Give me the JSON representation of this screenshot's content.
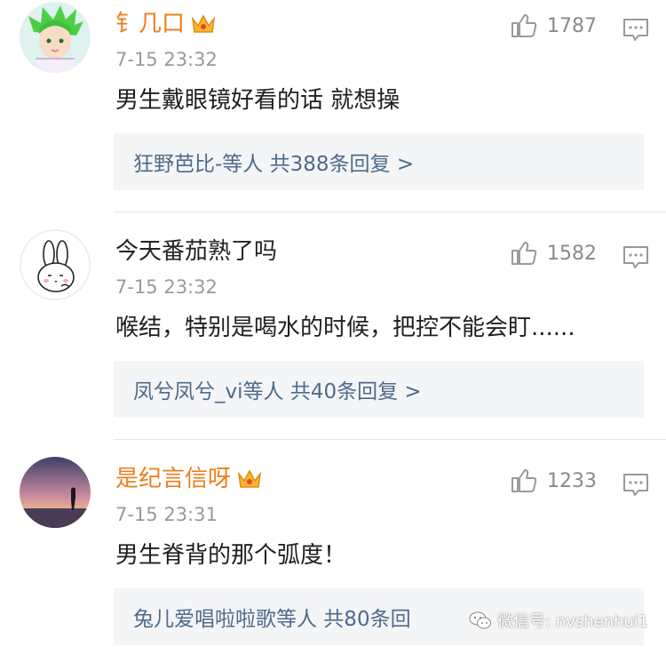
{
  "comments": [
    {
      "username": "钅几口",
      "time": "7-15 23:32",
      "text": "男生戴眼镜好看的话 就想操",
      "likes": "1787",
      "reply_summary": "狂野芭比-等人 共388条回复 >"
    },
    {
      "username": "今天番茄熟了吗",
      "time": "7-15 23:32",
      "text": "喉结，特别是喝水的时候，把控不能会盯......",
      "likes": "1582",
      "reply_summary": "凤兮凤兮_vi等人 共40条回复 >"
    },
    {
      "username": "是纪言信呀",
      "time": "7-15 23:31",
      "text": "男生脊背的那个弧度！",
      "likes": "1233",
      "reply_summary": "兔儿爱唱啦啦歌等人 共80条回"
    }
  ],
  "watermark": {
    "label": "微信号: nvshenhui1",
    "icon": "wechat-icon"
  },
  "colors": {
    "vip_name": "#ef7c1b",
    "reply_link": "#4d6b8a",
    "meta": "#9a9a9a"
  }
}
